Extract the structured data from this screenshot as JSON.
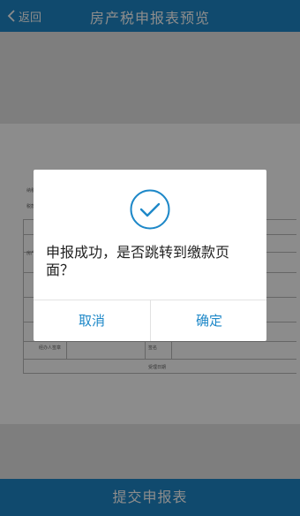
{
  "header": {
    "back_label": "返回",
    "title": "房产税申报表预览"
  },
  "preview_form": {
    "footer_text": "..."
  },
  "footer": {
    "submit_label": "提交申报表"
  },
  "dialog": {
    "message": "申报成功，是否跳转到缴款页面？",
    "cancel_label": "取消",
    "confirm_label": "确定",
    "icon": "check-circle-icon"
  },
  "colors": {
    "accent": "#1e88c8",
    "overlay": "rgba(0,0,0,0.45)"
  }
}
